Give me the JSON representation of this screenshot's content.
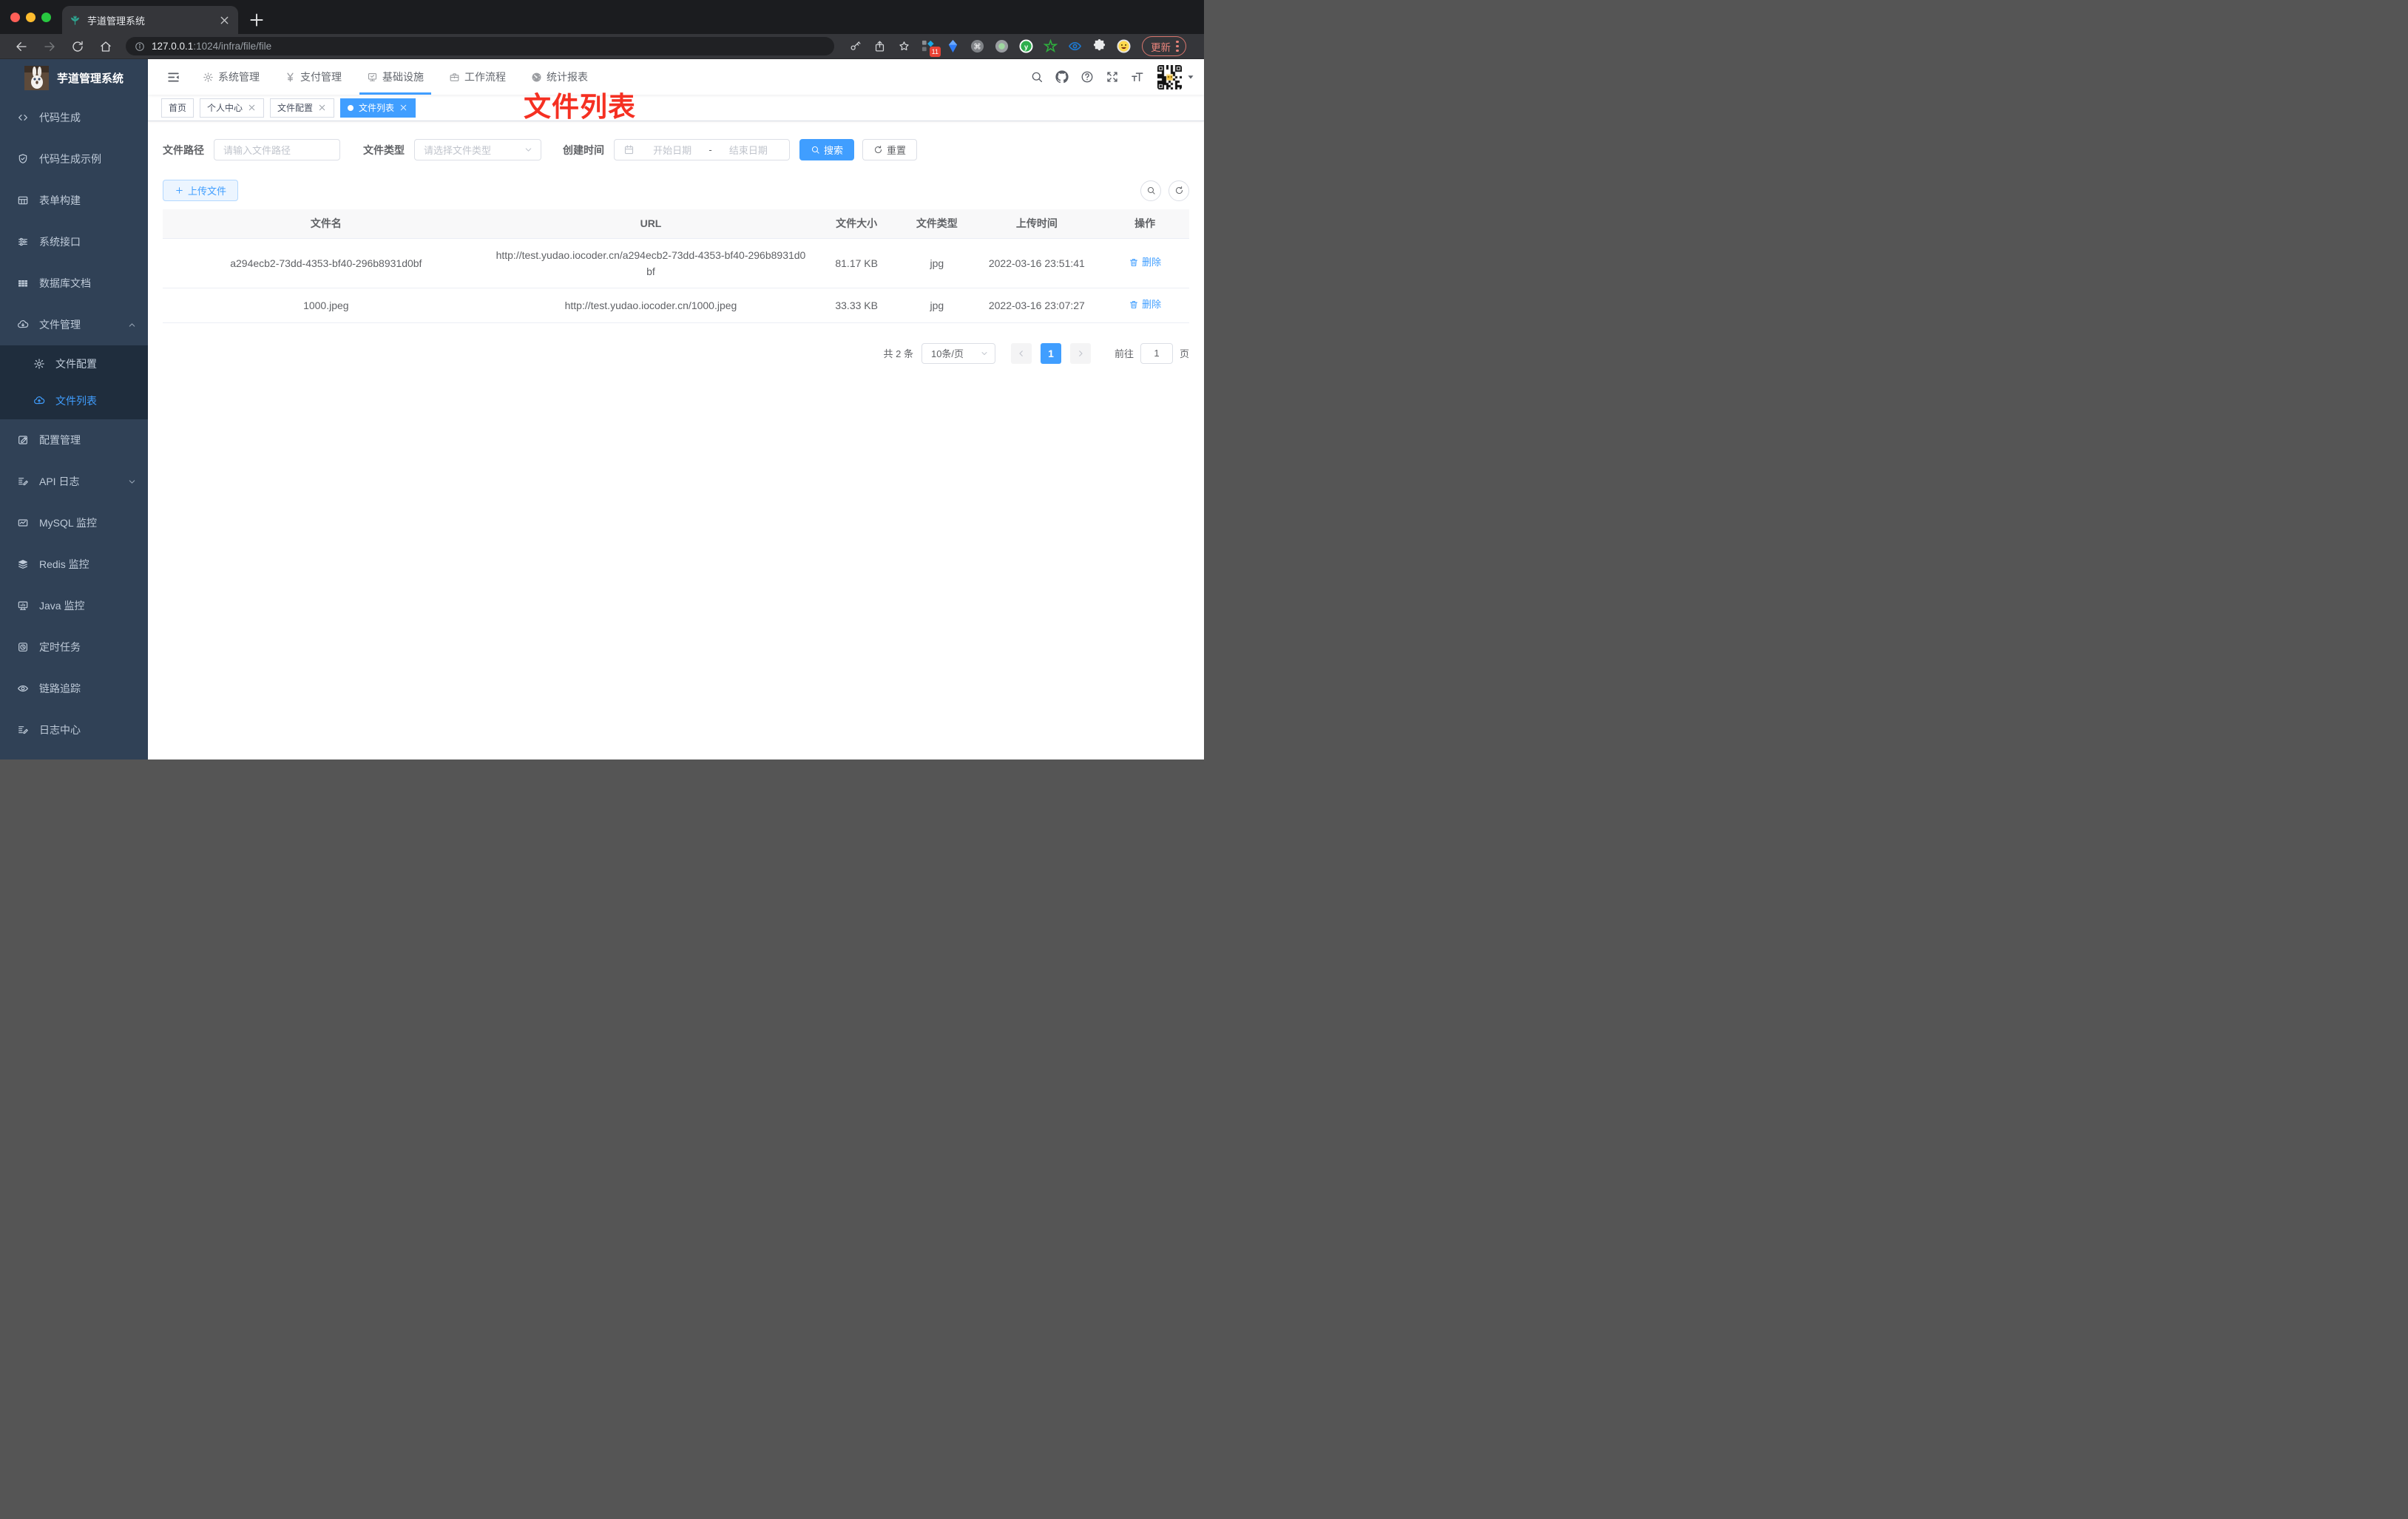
{
  "colors": {
    "accent": "#409eff",
    "annotation_red": "#f53022",
    "sidebar_bg": "#304156",
    "submenu_bg": "#1f2d3d"
  },
  "browser": {
    "tab_title": "芋道管理系统",
    "url_host": "127.0.0.1",
    "url_rest": ":1024/infra/file/file",
    "ext_badge": "11",
    "update_label": "更新"
  },
  "sidebar": {
    "title": "芋道管理系统",
    "items": [
      {
        "label": "代码生成",
        "icon": "code"
      },
      {
        "label": "代码生成示例",
        "icon": "shield"
      },
      {
        "label": "表单构建",
        "icon": "form"
      },
      {
        "label": "系统接口",
        "icon": "sliders"
      },
      {
        "label": "数据库文档",
        "icon": "dbgrid"
      },
      {
        "label": "文件管理",
        "icon": "cloud-down",
        "chevron": "chevron-up"
      },
      {
        "label": "文件配置",
        "icon": "gear",
        "sub": true
      },
      {
        "label": "文件列表",
        "icon": "cloud-up",
        "sub": true,
        "active": true
      },
      {
        "label": "配置管理",
        "icon": "edit"
      },
      {
        "label": "API 日志",
        "icon": "doc-edit",
        "chevron": "chevron-down"
      },
      {
        "label": "MySQL 监控",
        "icon": "chart"
      },
      {
        "label": "Redis 监控",
        "icon": "layers"
      },
      {
        "label": "Java 监控",
        "icon": "monitor"
      },
      {
        "label": "定时任务",
        "icon": "clock"
      },
      {
        "label": "链路追踪",
        "icon": "eye"
      },
      {
        "label": "日志中心",
        "icon": "doc-edit"
      }
    ]
  },
  "navbar": {
    "menus": [
      {
        "label": "系统管理",
        "icon": "gear"
      },
      {
        "label": "支付管理",
        "icon": "yen"
      },
      {
        "label": "基础设施",
        "icon": "monitor-check",
        "active": true
      },
      {
        "label": "工作流程",
        "icon": "briefcase"
      },
      {
        "label": "统计报表",
        "icon": "dashboard"
      }
    ]
  },
  "tags": [
    {
      "label": "首页"
    },
    {
      "label": "个人中心",
      "closable": true
    },
    {
      "label": "文件配置",
      "closable": true
    },
    {
      "label": "文件列表",
      "closable": true,
      "active": true
    }
  ],
  "annotation": "文件列表",
  "filters": {
    "path_label": "文件路径",
    "path_placeholder": "请输入文件路径",
    "type_label": "文件类型",
    "type_placeholder": "请选择文件类型",
    "time_label": "创建时间",
    "start_placeholder": "开始日期",
    "range_sep": "-",
    "end_placeholder": "结束日期",
    "search_label": "搜索",
    "reset_label": "重置"
  },
  "toolbar": {
    "upload_label": "上传文件"
  },
  "table": {
    "columns": [
      "文件名",
      "URL",
      "文件大小",
      "文件类型",
      "上传时间",
      "操作"
    ],
    "rows": [
      {
        "name": "a294ecb2-73dd-4353-bf40-296b8931d0bf",
        "url": "http://test.yudao.iocoder.cn/a294ecb2-73dd-4353-bf40-296b8931d0bf",
        "size": "81.17 KB",
        "type": "jpg",
        "time": "2022-03-16 23:51:41",
        "action": "删除"
      },
      {
        "name": "1000.jpeg",
        "url": "http://test.yudao.iocoder.cn/1000.jpeg",
        "size": "33.33 KB",
        "type": "jpg",
        "time": "2022-03-16 23:07:27",
        "action": "删除"
      }
    ]
  },
  "pagination": {
    "total": "共 2 条",
    "page_size": "10条/页",
    "current": "1",
    "goto_label": "前往",
    "goto_value": "1",
    "page_label": "页"
  }
}
